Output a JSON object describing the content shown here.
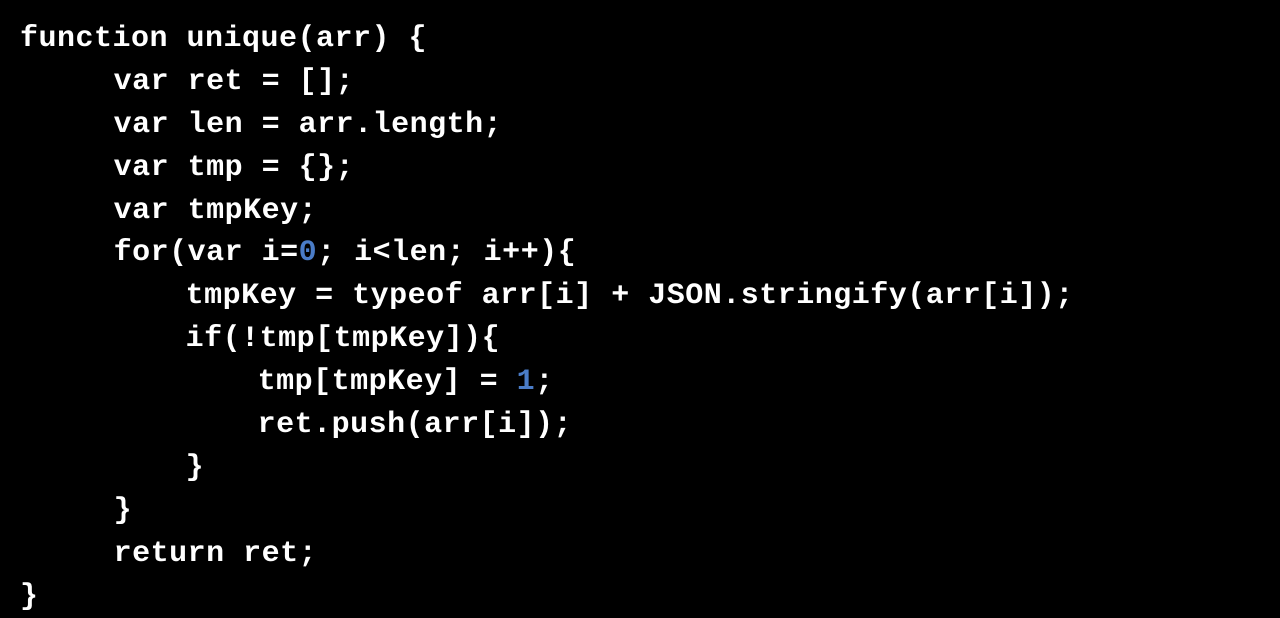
{
  "code": {
    "lines": [
      {
        "indent": 0,
        "segments": [
          {
            "t": "function unique(arr) {",
            "c": ""
          }
        ]
      },
      {
        "indent": 1,
        "segments": [
          {
            "t": "var ret = [];",
            "c": ""
          }
        ]
      },
      {
        "indent": 1,
        "segments": [
          {
            "t": "var len = arr.length;",
            "c": ""
          }
        ]
      },
      {
        "indent": 1,
        "segments": [
          {
            "t": "var tmp = {};",
            "c": ""
          }
        ]
      },
      {
        "indent": 1,
        "segments": [
          {
            "t": "var tmpKey;",
            "c": ""
          }
        ]
      },
      {
        "indent": 1,
        "segments": [
          {
            "t": "for(var i=",
            "c": ""
          },
          {
            "t": "0",
            "c": "number"
          },
          {
            "t": "; i<len; i++){",
            "c": ""
          }
        ]
      },
      {
        "indent": 2,
        "segments": [
          {
            "t": "tmpKey = typeof arr[i] + JSON.stringify(arr[i]);",
            "c": ""
          }
        ]
      },
      {
        "indent": 2,
        "segments": [
          {
            "t": "if(!tmp[tmpKey]){",
            "c": ""
          }
        ]
      },
      {
        "indent": 3,
        "segments": [
          {
            "t": "tmp[tmpKey] = ",
            "c": ""
          },
          {
            "t": "1",
            "c": "number"
          },
          {
            "t": ";",
            "c": ""
          }
        ]
      },
      {
        "indent": 3,
        "segments": [
          {
            "t": "ret.push(arr[i]);",
            "c": ""
          }
        ]
      },
      {
        "indent": 2,
        "segments": [
          {
            "t": "}",
            "c": ""
          }
        ]
      },
      {
        "indent": 1,
        "segments": [
          {
            "t": "}",
            "c": ""
          }
        ]
      },
      {
        "indent": 1,
        "segments": [
          {
            "t": "return ret;",
            "c": ""
          }
        ]
      },
      {
        "indent": 0,
        "segments": [
          {
            "t": "}",
            "c": ""
          }
        ]
      }
    ]
  }
}
